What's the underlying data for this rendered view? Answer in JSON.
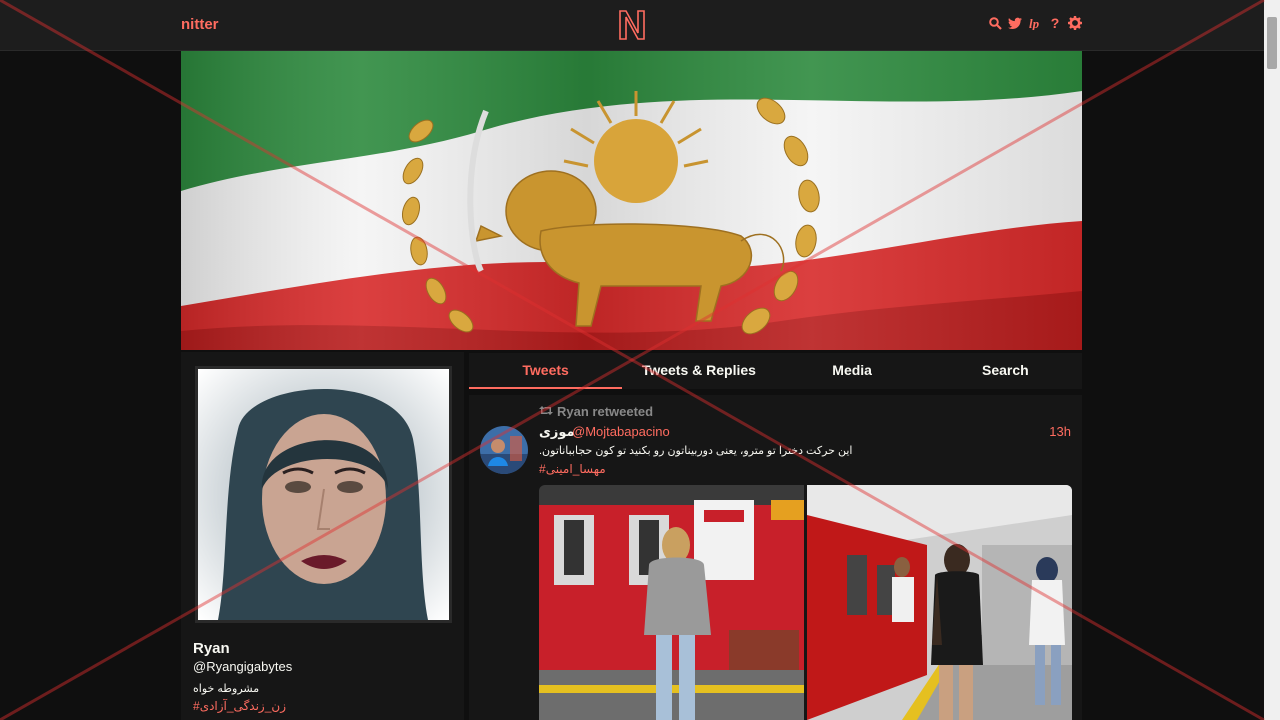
{
  "nav": {
    "brand": "nitter",
    "icons": [
      "search-icon",
      "twitter-icon",
      "liberapay-icon",
      "help-icon",
      "settings-icon"
    ],
    "help_glyph": "?"
  },
  "colors": {
    "accent": "#ff6c60",
    "bg": "#0f0f0f",
    "panel": "#161616",
    "nav": "#1d1d1d"
  },
  "profile": {
    "name": "Ryan",
    "handle": "@Ryangigabytes",
    "bio": "مشروطه خواه",
    "hashtag": "#زن_زندگی_آزادی"
  },
  "tabs": [
    {
      "label": "Tweets",
      "active": true
    },
    {
      "label": "Tweets & Replies",
      "active": false
    },
    {
      "label": "Media",
      "active": false
    },
    {
      "label": "Search",
      "active": false
    }
  ],
  "tweet": {
    "retweet_label": "Ryan retweeted",
    "fullname": "موزی",
    "username": "@Mojtabapacino",
    "date": "13h",
    "content": "این حرکت دخترا تو مترو، یعنی دوربیناتون رو بکنید تو کون حجابباناتون.",
    "hashtag": "#مهسا_امینی"
  }
}
